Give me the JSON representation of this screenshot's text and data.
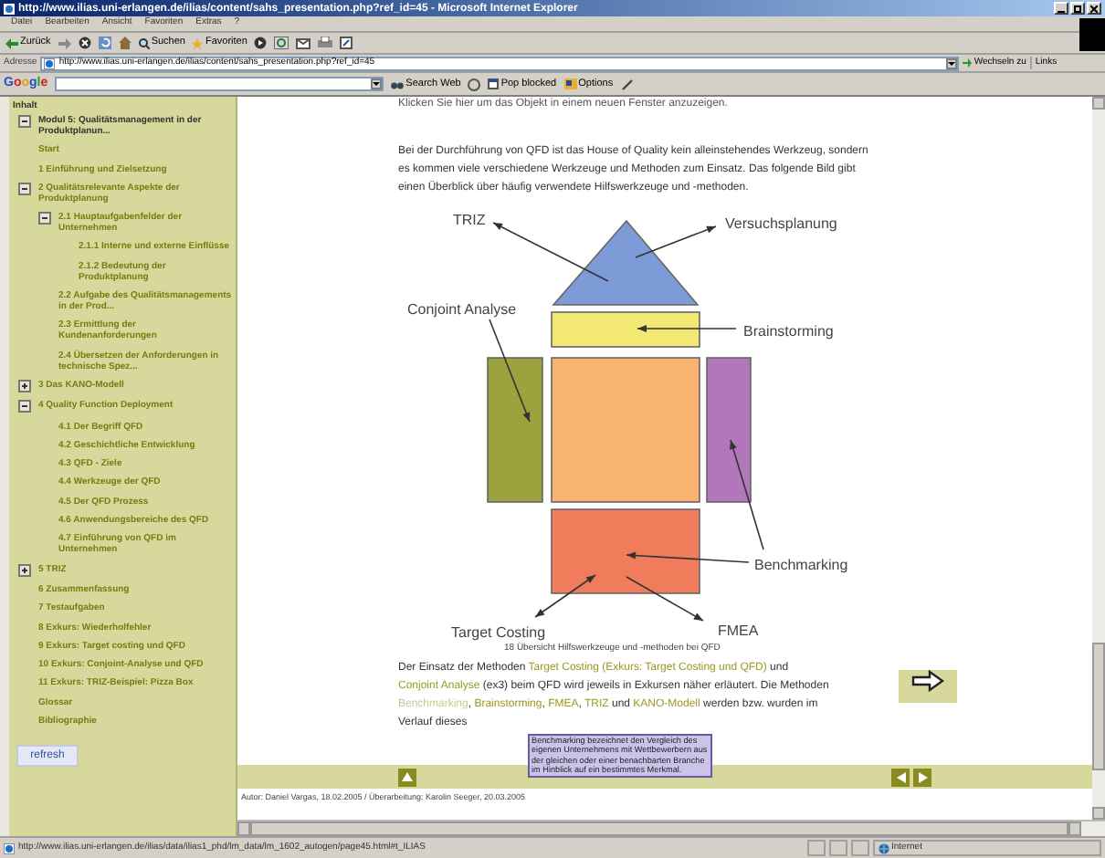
{
  "window": {
    "title": "http://www.ilias.uni-erlangen.de/ilias/content/sahs_presentation.php?ref_id=45 - Microsoft Internet Explorer"
  },
  "menu_bar": [
    "Datei",
    "Bearbeiten",
    "Ansicht",
    "Favoriten",
    "Extras",
    "?"
  ],
  "toolbar": {
    "back_label": "Zurück",
    "search_label": "Suchen",
    "favorites_label": "Favoriten"
  },
  "address_bar": {
    "label": "Adresse",
    "value": "http://www.ilias.uni-erlangen.de/ilias/content/sahs_presentation.php?ref_id=45",
    "go_label": "Wechseln zu",
    "links_label": "Links"
  },
  "google_toolbar": {
    "logo": "Google",
    "search_label": "Search Web",
    "blocked_label": "Pop blocked",
    "options_label": "Options"
  },
  "sidebar": {
    "heading": "Inhalt",
    "refresh_label": "refresh",
    "tree": [
      {
        "label": "Modul 5: Qualitätsmanagement in der Produktplanun...",
        "expanded": true
      },
      {
        "label": "Start"
      },
      {
        "label": "1 Einführung und Zielsetzung"
      },
      {
        "label": "2 Qualitätsrelevante Aspekte der Produktplanung",
        "expanded": true,
        "children": [
          {
            "label": "2.1 Hauptaufgabenfelder der Unternehmen",
            "expanded": true,
            "children": [
              {
                "label": "2.1.1 Interne und externe Einflüsse"
              },
              {
                "label": "2.1.2 Bedeutung der Produktplanung"
              }
            ]
          },
          {
            "label": "2.2 Aufgabe des Qualitätsmanagements in der Prod..."
          },
          {
            "label": "2.3 Ermittlung der Kundenanforderungen"
          },
          {
            "label": "2.4 Übersetzen der Anforderungen in technische Spez..."
          }
        ]
      },
      {
        "label": "3 Das KANO-Modell",
        "expanded": false
      },
      {
        "label": "4 Quality Function Deployment",
        "expanded": true,
        "children": [
          {
            "label": "4.1 Der Begriff QFD"
          },
          {
            "label": "4.2 Geschichtliche Entwicklung"
          },
          {
            "label": "4.3 QFD - Ziele"
          },
          {
            "label": "4.4 Werkzeuge der QFD"
          },
          {
            "label": "4.5 Der QFD Prozess"
          },
          {
            "label": "4.6 Anwendungsbereiche des QFD"
          },
          {
            "label": "4.7 Einführung von QFD im Unternehmen"
          }
        ]
      },
      {
        "label": "5 TRIZ",
        "expanded": false
      },
      {
        "label": "6 Zusammenfassung"
      },
      {
        "label": "7 Testaufgaben"
      },
      {
        "label": "8 Exkurs: Wiederholfehler"
      },
      {
        "label": "9 Exkurs: Target costing und QFD"
      },
      {
        "label": "10 Exkurs: Conjoint-Analyse und QFD"
      },
      {
        "label": "11 Exkurs: TRIZ-Beispiel: Pizza Box"
      },
      {
        "label": "Glossar"
      },
      {
        "label": "Bibliographie"
      }
    ]
  },
  "content": {
    "top_line": "Klicken Sie hier um das Objekt in einem neuen Fenster anzuzeigen.",
    "intro": "Bei der Durchführung von QFD ist das House of Quality kein alleinstehendes Werkzeug, sondern es kommen viele verschiedene Werkzeuge und Methoden zum Einsatz. Das folgende Bild gibt einen Überblick über häufig verwendete Hilfswerkzeuge und -methoden.",
    "figure": {
      "labels": [
        "TRIZ",
        "Versuchsplanung",
        "Conjoint Analyse",
        "Brainstorming",
        "Benchmarking",
        "Target Costing",
        "FMEA"
      ],
      "caption": "18 Übersicht Hilfswerkzeuge und -methoden bei QFD"
    },
    "body": [
      {
        "text": "Der Einsatz der Methoden ",
        "link": false
      },
      {
        "text": "Target Costing (Exkurs: Target Costing und QFD)",
        "link": true,
        "hovered": false
      },
      {
        "text": " und ",
        "link": false
      },
      {
        "text": "Conjoint Analyse",
        "link": true,
        "hovered": false
      },
      {
        "text": " (ex3) beim QFD wird jeweils in Exkursen näher erläutert. Die Methoden ",
        "link": false
      },
      {
        "text": "Benchmarking",
        "link": true,
        "hovered": true
      },
      {
        "text": ", ",
        "link": false
      },
      {
        "text": "Brainstorming",
        "link": true,
        "hovered": false
      },
      {
        "text": ", ",
        "link": false
      },
      {
        "text": "FMEA",
        "link": true,
        "hovered": false
      },
      {
        "text": ", ",
        "link": false
      },
      {
        "text": "TRIZ",
        "link": true,
        "hovered": false
      },
      {
        "text": " und ",
        "link": false
      },
      {
        "text": "KANO-Modell",
        "link": true,
        "hovered": false
      },
      {
        "text": " werden bzw. wurden im Verlauf dieses",
        "link": false
      }
    ],
    "tooltip": "Benchmarking bezeichnet den Vergleich des eigenen Unternehmens mit Wettbewerbern aus der gleichen oder einer benachbarten Branche im Hinblick auf ein bestimmtes Merkmal.",
    "author": "Autor: Daniel Vargas, 18.02.2005 / Überarbeitung: Karolin Seeger, 20.03.2005"
  },
  "status_bar": {
    "url": "http://www.ilias.uni-erlangen.de/ilias/data/ilias1_phd/lm_data/lm_1602_autogen/page45.html#t_ILIAS",
    "zone": "Internet"
  }
}
